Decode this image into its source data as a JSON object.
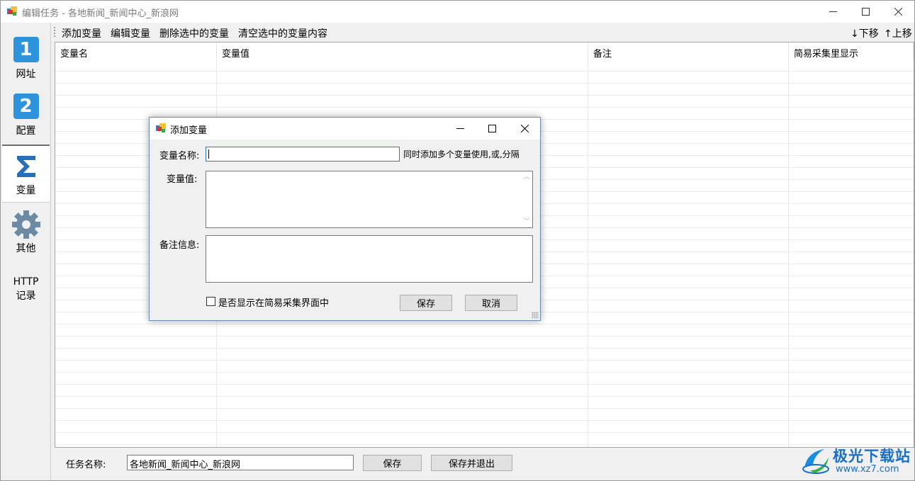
{
  "window": {
    "title": "编辑任务 - 各地新闻_新闻中心_新浪网"
  },
  "sidebar": {
    "items": [
      {
        "label": "网址",
        "icon": "number-1-icon",
        "glyph": "1"
      },
      {
        "label": "配置",
        "icon": "number-2-icon",
        "glyph": "2"
      },
      {
        "label": "变量",
        "icon": "sigma-icon",
        "active": true
      },
      {
        "label": "其他",
        "icon": "gear-icon"
      },
      {
        "label_line1": "HTTP",
        "label_line2": "记录"
      }
    ]
  },
  "toolbar": {
    "add": "添加变量",
    "edit": "编辑变量",
    "delete": "删除选中的变量",
    "clear": "清空选中的变量内容",
    "move_down": "↓下移",
    "move_up": "↑上移"
  },
  "grid": {
    "columns": [
      "变量名",
      "变量值",
      "备注",
      "简易采集里显示"
    ]
  },
  "bottom": {
    "task_label": "任务名称:",
    "task_value": "各地新闻_新闻中心_新浪网",
    "save": "保存",
    "save_exit": "保存并退出"
  },
  "dialog": {
    "title": "添加变量",
    "name_label": "变量名称:",
    "name_value": "",
    "name_hint": "同时添加多个变量使用,或,分隔",
    "value_label": "变量值:",
    "note_label": "备注信息:",
    "checkbox_label": "是否显示在简易采集界面中",
    "checkbox_checked": false,
    "save": "保存",
    "cancel": "取消"
  },
  "watermark": {
    "text_cn": "极光下载站",
    "text_url": "www.xz7.com"
  },
  "colors": {
    "accent": "#2f93dc",
    "focus_border": "#2c79c6",
    "watermark": "#1a6fc4"
  }
}
